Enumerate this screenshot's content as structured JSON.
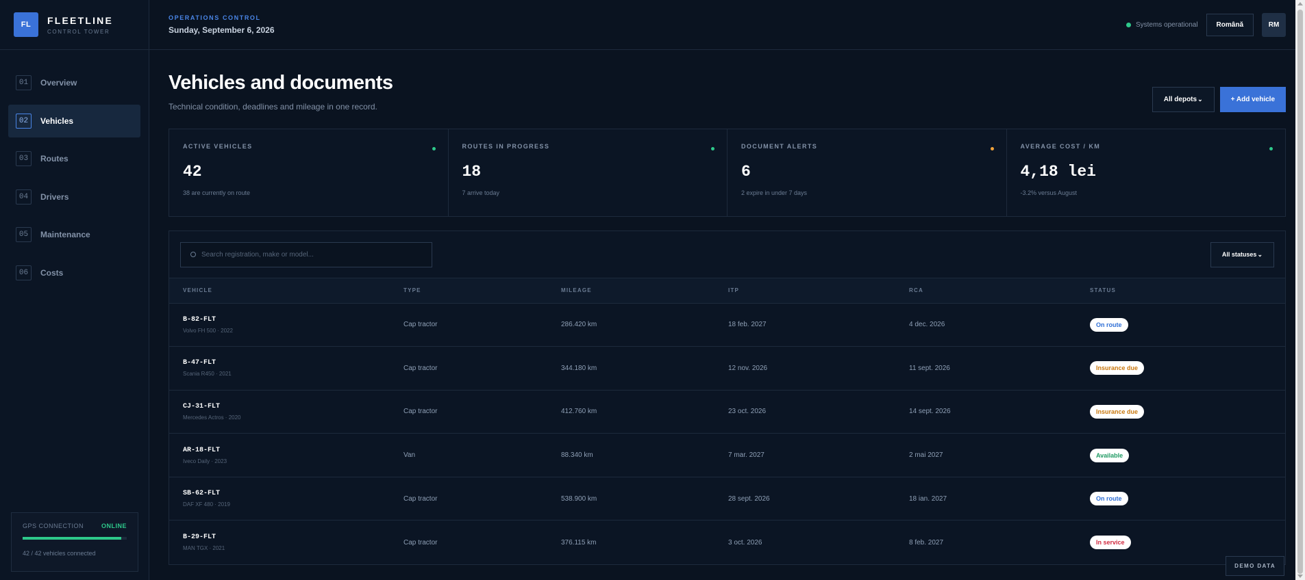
{
  "brand": {
    "logo": "FL",
    "name": "FLEETLINE",
    "sub": "CONTROL TOWER"
  },
  "nav": [
    {
      "num": "01",
      "label": "Overview"
    },
    {
      "num": "02",
      "label": "Vehicles"
    },
    {
      "num": "03",
      "label": "Routes"
    },
    {
      "num": "04",
      "label": "Drivers"
    },
    {
      "num": "05",
      "label": "Maintenance"
    },
    {
      "num": "06",
      "label": "Costs"
    }
  ],
  "gps": {
    "label": "GPS CONNECTION",
    "status": "ONLINE",
    "progress": 0.95,
    "text": "42 / 42 vehicles connected"
  },
  "topbar": {
    "eyebrow": "OPERATIONS CONTROL",
    "date": "Sunday, September 6, 2026",
    "status_text": "Systems operational",
    "lang": "Română",
    "avatar": "RM"
  },
  "page": {
    "title": "Vehicles and documents",
    "subtitle": "Technical condition, deadlines and mileage in one record.",
    "depots_label": "All depots",
    "add_label": "+ Add vehicle"
  },
  "kpis": [
    {
      "label": "ACTIVE VEHICLES",
      "value": "42",
      "note": "38 are currently on route",
      "dot_color": "#2ec98b"
    },
    {
      "label": "ROUTES IN PROGRESS",
      "value": "18",
      "note": "7 arrive today",
      "dot_color": "#2ec98b"
    },
    {
      "label": "DOCUMENT ALERTS",
      "value": "6",
      "note": "2 expire in under 7 days",
      "dot_color": "#f0a23b"
    },
    {
      "label": "AVERAGE COST / KM",
      "value": "4,18 lei",
      "note": "-3.2% versus August",
      "dot_color": "#2ec98b"
    }
  ],
  "table": {
    "search_placeholder": "Search registration, make or model...",
    "status_filter": "All statuses",
    "columns": [
      "VEHICLE",
      "TYPE",
      "MILEAGE",
      "ITP",
      "RCA",
      "STATUS"
    ],
    "rows": [
      {
        "plate": "B-82-FLT",
        "model": "Volvo FH 500 · 2022",
        "type": "Cap tractor",
        "mileage": "286.420 km",
        "itp": "18 feb. 2027",
        "rca": "4 dec. 2026",
        "status": "On route",
        "status_color": "#2f6fd6"
      },
      {
        "plate": "B-47-FLT",
        "model": "Scania R450 · 2021",
        "type": "Cap tractor",
        "mileage": "344.180 km",
        "itp": "12 nov. 2026",
        "rca": "11 sept. 2026",
        "status": "Insurance due",
        "status_color": "#c9780f"
      },
      {
        "plate": "CJ-31-FLT",
        "model": "Mercedes Actros · 2020",
        "type": "Cap tractor",
        "mileage": "412.760 km",
        "itp": "23 oct. 2026",
        "rca": "14 sept. 2026",
        "status": "Insurance due",
        "status_color": "#c9780f"
      },
      {
        "plate": "AR-18-FLT",
        "model": "Iveco Daily · 2023",
        "type": "Van",
        "mileage": "88.340 km",
        "itp": "7 mar. 2027",
        "rca": "2 mai 2027",
        "status": "Available",
        "status_color": "#1f9a63"
      },
      {
        "plate": "SB-62-FLT",
        "model": "DAF XF 480 · 2019",
        "type": "Cap tractor",
        "mileage": "538.900 km",
        "itp": "28 sept. 2026",
        "rca": "18 ian. 2027",
        "status": "On route",
        "status_color": "#2f6fd6"
      },
      {
        "plate": "B-29-FLT",
        "model": "MAN TGX · 2021",
        "type": "Cap tractor",
        "mileage": "376.115 km",
        "itp": "3 oct. 2026",
        "rca": "8 feb. 2027",
        "status": "In service",
        "status_color": "#d12a3f"
      }
    ]
  },
  "demo_tag": "DEMO DATA"
}
